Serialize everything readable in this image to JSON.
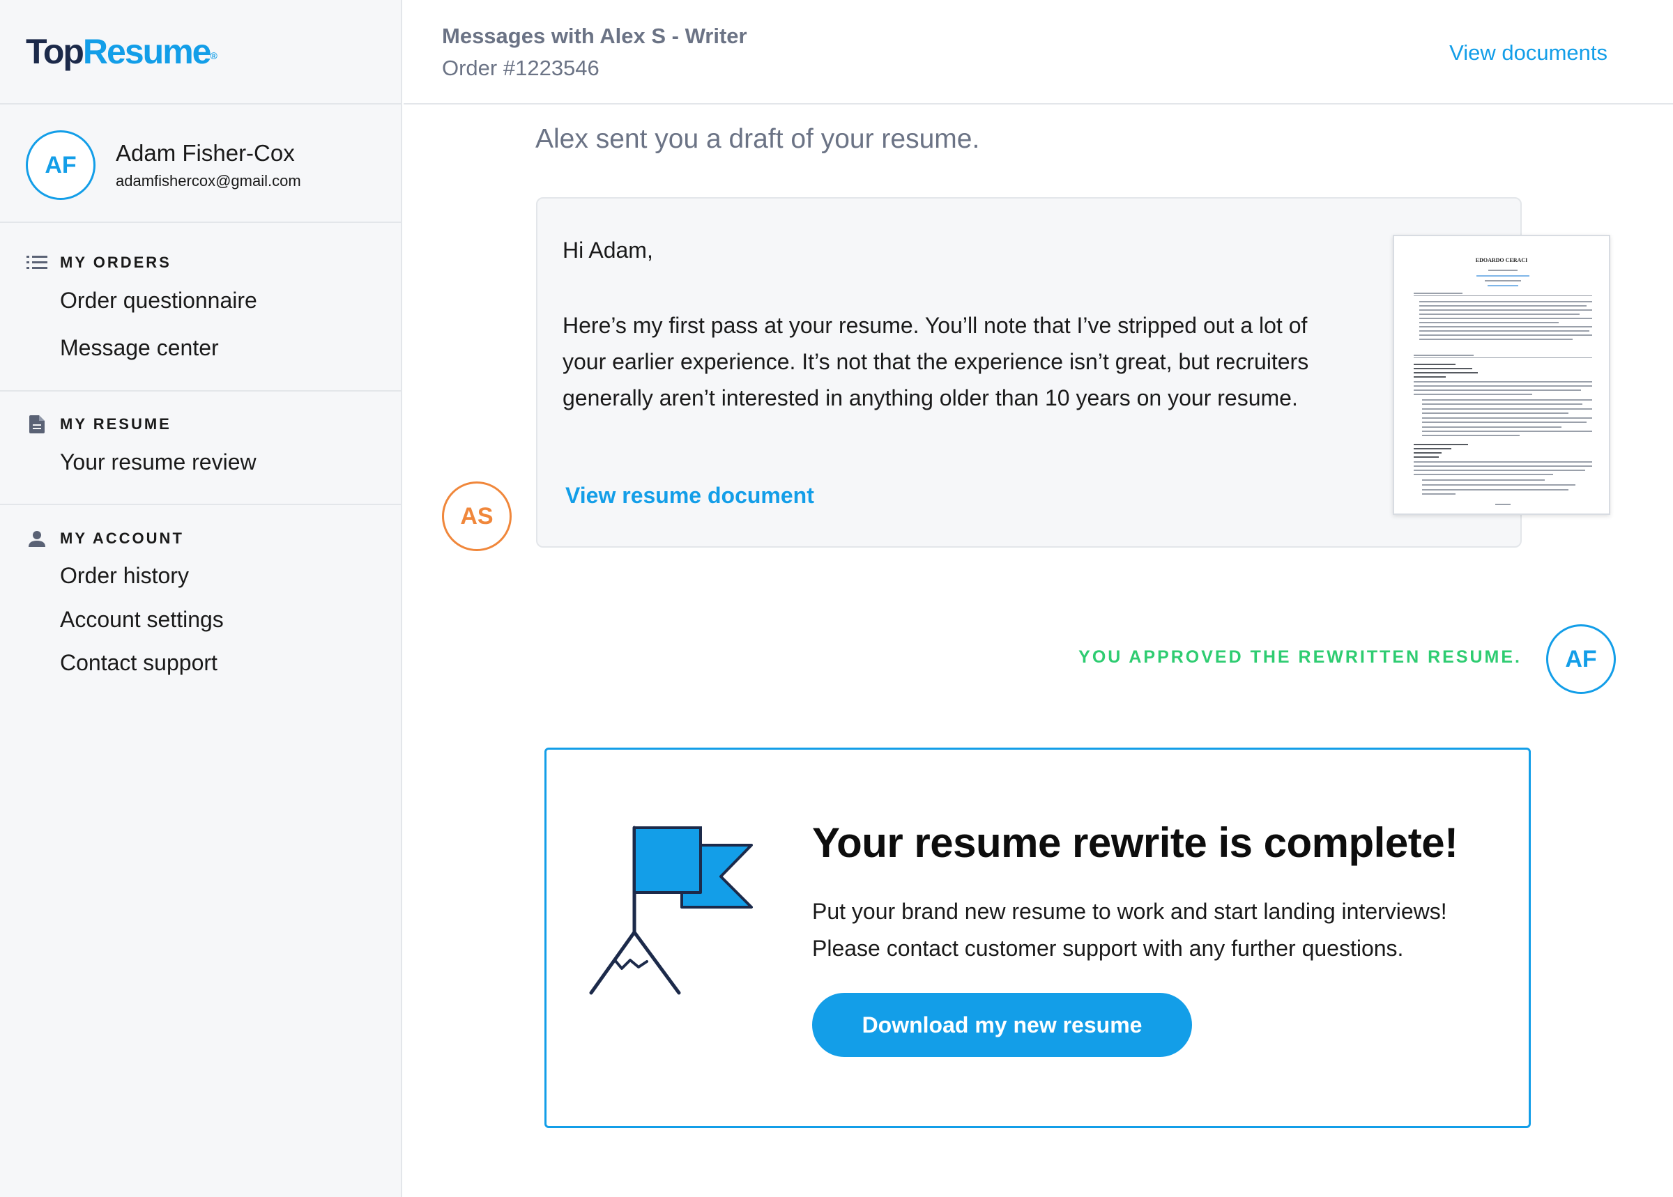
{
  "brand": {
    "logo_top": "Top",
    "logo_resume": "Resume",
    "logo_mark": "®",
    "accent": "#139ee8"
  },
  "profile": {
    "initials": "AF",
    "name": "Adam Fisher-Cox",
    "email": "adamfishercox@gmail.com"
  },
  "sidebar": {
    "orders": {
      "icon": "list-icon",
      "label": "MY ORDERS",
      "items": [
        "Order questionnaire",
        "Message center"
      ]
    },
    "resume": {
      "icon": "document-icon",
      "label": "MY RESUME",
      "items": [
        "Your resume review"
      ]
    },
    "account": {
      "icon": "person-icon",
      "label": "MY ACCOUNT",
      "items": [
        "Order history",
        "Account settings",
        "Contact support"
      ]
    }
  },
  "header": {
    "title": "Messages with Alex S - Writer",
    "order": "Order #1223546",
    "view_documents": "View documents"
  },
  "thread": {
    "draft_title": "Alex sent you a draft of your resume.",
    "message": {
      "sender_initials": "AS",
      "greeting": "Hi Adam,",
      "body": "Here’s my first pass at your resume. You’ll note that I’ve stripped out a lot of your earlier experience. It’s not that the experience isn’t great, but recruiters generally aren’t interested in anything older than 10 years on your resume.",
      "link": "View resume document",
      "thumbnail_name": "EDOARDO CERACI"
    },
    "approval": {
      "text": "YOU APPROVED THE REWRITTEN RESUME.",
      "initials": "AF",
      "color": "#2ecc71"
    }
  },
  "complete": {
    "title": "Your resume rewrite is complete!",
    "line1": "Put your brand new resume to work and start landing interviews!",
    "line2": "Please contact customer support with any further questions.",
    "button": "Download my new resume",
    "icon": "flag-on-mountain-icon"
  }
}
